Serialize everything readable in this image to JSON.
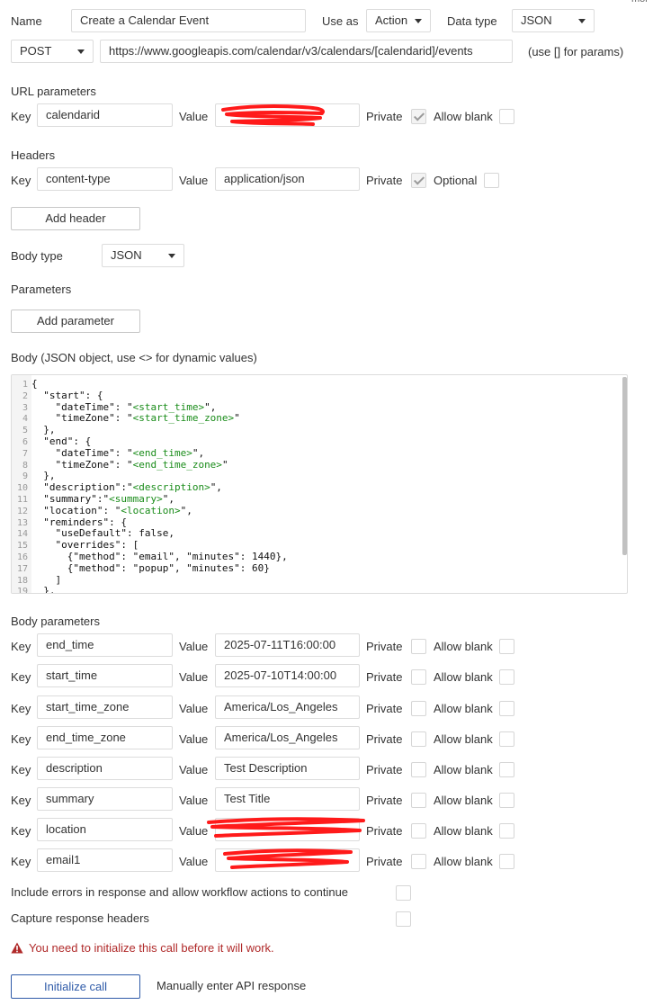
{
  "top": {
    "name_label": "Name",
    "name_value": "Create a Calendar Event",
    "use_as_label": "Use as",
    "use_as_value": "Action",
    "data_type_label": "Data type",
    "data_type_value": "JSON",
    "corner_text": "mor"
  },
  "request": {
    "method": "POST",
    "url": "https://www.googleapis.com/calendar/v3/calendars/[calendarid]/events",
    "params_hint": "(use [] for params)"
  },
  "url_params": {
    "title": "URL parameters",
    "key_label": "Key",
    "key": "calendarid",
    "value_label": "Value",
    "private_label": "Private",
    "private_checked": true,
    "allow_blank_label": "Allow blank"
  },
  "headers": {
    "title": "Headers",
    "key_label": "Key",
    "key": "content-type",
    "value_label": "Value",
    "value": "application/json",
    "private_label": "Private",
    "private_checked": true,
    "optional_label": "Optional",
    "add_label": "Add header"
  },
  "body_type": {
    "label": "Body type",
    "value": "JSON"
  },
  "parameters": {
    "title": "Parameters",
    "add_label": "Add parameter"
  },
  "body": {
    "title": "Body (JSON object, use <> for dynamic values)",
    "lines": [
      "{",
      "  \"start\": {",
      "    \"dateTime\": \"<start_time>\",",
      "    \"timeZone\": \"<start_time_zone>\"",
      "  },",
      "  \"end\": {",
      "    \"dateTime\": \"<end_time>\",",
      "    \"timeZone\": \"<end_time_zone>\"",
      "  },",
      "  \"description\":\"<description>\",",
      "  \"summary\":\"<summary>\",",
      "  \"location\": \"<location>\",",
      "  \"reminders\": {",
      "    \"useDefault\": false,",
      "    \"overrides\": [",
      "      {\"method\": \"email\", \"minutes\": 1440},",
      "      {\"method\": \"popup\", \"minutes\": 60}",
      "    ]",
      "  },"
    ]
  },
  "body_params": {
    "title": "Body parameters",
    "key_label": "Key",
    "value_label": "Value",
    "private_label": "Private",
    "allow_blank_label": "Allow blank",
    "rows": [
      {
        "key": "end_time",
        "value": "2025-07-11T16:00:00"
      },
      {
        "key": "start_time",
        "value": "2025-07-10T14:00:00"
      },
      {
        "key": "start_time_zone",
        "value": "America/Los_Angeles"
      },
      {
        "key": "end_time_zone",
        "value": "America/Los_Angeles"
      },
      {
        "key": "description",
        "value": "Test Description"
      },
      {
        "key": "summary",
        "value": "Test Title"
      },
      {
        "key": "location",
        "value": ""
      },
      {
        "key": "email1",
        "value": ""
      }
    ]
  },
  "options": {
    "include_errors": "Include errors in response and allow workflow actions to continue",
    "capture_headers": "Capture response headers"
  },
  "warning": "You need to initialize this call before it will work.",
  "footer": {
    "initialize": "Initialize call",
    "manual": "Manually enter API response"
  },
  "colors": {
    "warning": "#b02a2a",
    "primary_button": "#2e5aa8",
    "redaction": "#ff1a1a",
    "json_placeholder": "#1a8c1a"
  }
}
